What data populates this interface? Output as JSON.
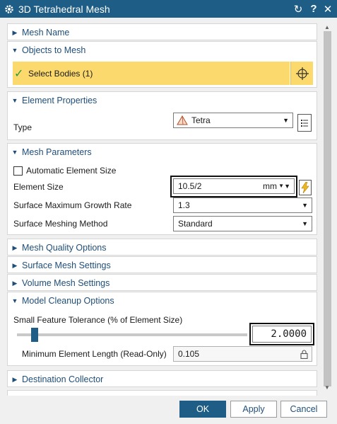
{
  "window": {
    "title": "3D Tetrahedral Mesh"
  },
  "sections": {
    "mesh_name": {
      "label": "Mesh Name"
    },
    "objects_to_mesh": {
      "label": "Objects to Mesh",
      "select_bodies": "Select Bodies (1)"
    },
    "element_properties": {
      "label": "Element Properties",
      "type_label": "Type",
      "type_value": "Tetra"
    },
    "mesh_parameters": {
      "label": "Mesh Parameters",
      "auto_size_label": "Automatic Element Size",
      "auto_size_checked": false,
      "element_size_label": "Element Size",
      "element_size_value": "10.5/2",
      "element_size_unit": "mm",
      "growth_label": "Surface Maximum Growth Rate",
      "growth_value": "1.3",
      "method_label": "Surface Meshing Method",
      "method_value": "Standard"
    },
    "mesh_quality": {
      "label": "Mesh Quality Options"
    },
    "surface_mesh": {
      "label": "Surface Mesh Settings"
    },
    "volume_mesh": {
      "label": "Volume Mesh Settings"
    },
    "model_cleanup": {
      "label": "Model Cleanup Options",
      "tolerance_label": "Small Feature Tolerance (% of Element Size)",
      "tolerance_value": "2.0000",
      "tolerance_slider_fraction": 0.06,
      "min_length_label": "Minimum Element Length (Read-Only)",
      "min_length_value": "0.105"
    },
    "destination": {
      "label": "Destination Collector"
    }
  },
  "footer": {
    "ok": "OK",
    "apply": "Apply",
    "cancel": "Cancel"
  },
  "colors": {
    "titlebar": "#1e5d86",
    "highlight": "#fbd96d",
    "section_text": "#1f4e79"
  }
}
